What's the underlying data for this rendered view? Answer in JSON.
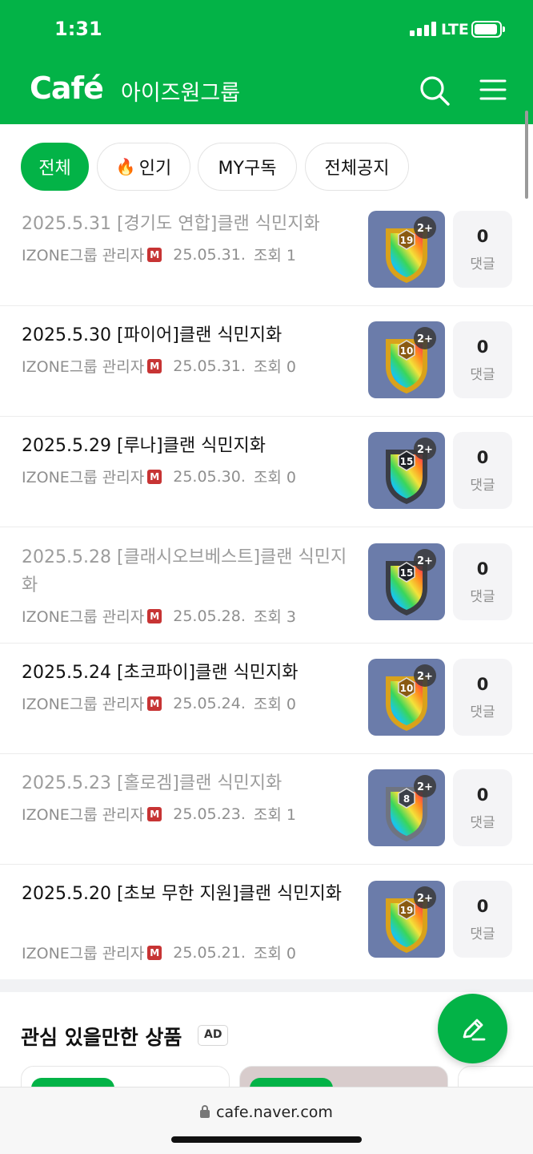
{
  "status_bar": {
    "time": "1:31",
    "network": "LTE"
  },
  "header": {
    "logo": "Café",
    "cafe_name": "아이즈원그룹"
  },
  "chips": [
    {
      "label": "전체",
      "active": true
    },
    {
      "label": "인기",
      "active": false,
      "icon": "flame-icon"
    },
    {
      "label": "MY구독",
      "active": false
    },
    {
      "label": "전체공지",
      "active": false
    }
  ],
  "posts": [
    {
      "title": "2025.5.31 [경기도 연합]클랜 식민지화",
      "author": "IZONE그룹 관리자",
      "badge": "M",
      "date": "25.05.31.",
      "views": "조회 1",
      "comments": "0",
      "comments_label": "댓글",
      "read": true,
      "level": "19",
      "plus": "2+",
      "shield": "gold"
    },
    {
      "title": "2025.5.30 [파이어]클랜 식민지화",
      "author": "IZONE그룹 관리자",
      "badge": "M",
      "date": "25.05.31.",
      "views": "조회 0",
      "comments": "0",
      "comments_label": "댓글",
      "read": false,
      "level": "10",
      "plus": "2+",
      "shield": "gold"
    },
    {
      "title": "2025.5.29 [루나]클랜 식민지화",
      "author": "IZONE그룹 관리자",
      "badge": "M",
      "date": "25.05.30.",
      "views": "조회 0",
      "comments": "0",
      "comments_label": "댓글",
      "read": false,
      "level": "15",
      "plus": "2+",
      "shield": "dark"
    },
    {
      "title": "2025.5.28 [클래시오브베스트]클랜 식민지화",
      "author": "IZONE그룹 관리자",
      "badge": "M",
      "date": "25.05.28.",
      "views": "조회 3",
      "comments": "0",
      "comments_label": "댓글",
      "read": true,
      "level": "15",
      "plus": "2+",
      "shield": "dark"
    },
    {
      "title": "2025.5.24 [초코파이]클랜 식민지화",
      "author": "IZONE그룹 관리자",
      "badge": "M",
      "date": "25.05.24.",
      "views": "조회 0",
      "comments": "0",
      "comments_label": "댓글",
      "read": false,
      "level": "10",
      "plus": "2+",
      "shield": "gold"
    },
    {
      "title": "2025.5.23 [홀로겜]클랜 식민지화",
      "author": "IZONE그룹 관리자",
      "badge": "M",
      "date": "25.05.23.",
      "views": "조회 1",
      "comments": "0",
      "comments_label": "댓글",
      "read": true,
      "level": "8",
      "plus": "2+",
      "shield": "silver"
    },
    {
      "title": "2025.5.20 [초보 무한 지원]클랜 식민지화",
      "author": "IZONE그룹 관리자",
      "badge": "M",
      "date": "25.05.21.",
      "views": "조회 0",
      "comments": "0",
      "comments_label": "댓글",
      "read": false,
      "level": "19",
      "plus": "2+",
      "shield": "gold"
    }
  ],
  "recommend": {
    "title": "관심 있을만한 상품",
    "ad_label": "AD"
  },
  "browser": {
    "url": "cafe.naver.com"
  },
  "colors": {
    "brand": "#03b347",
    "manager_badge": "#c73434"
  }
}
